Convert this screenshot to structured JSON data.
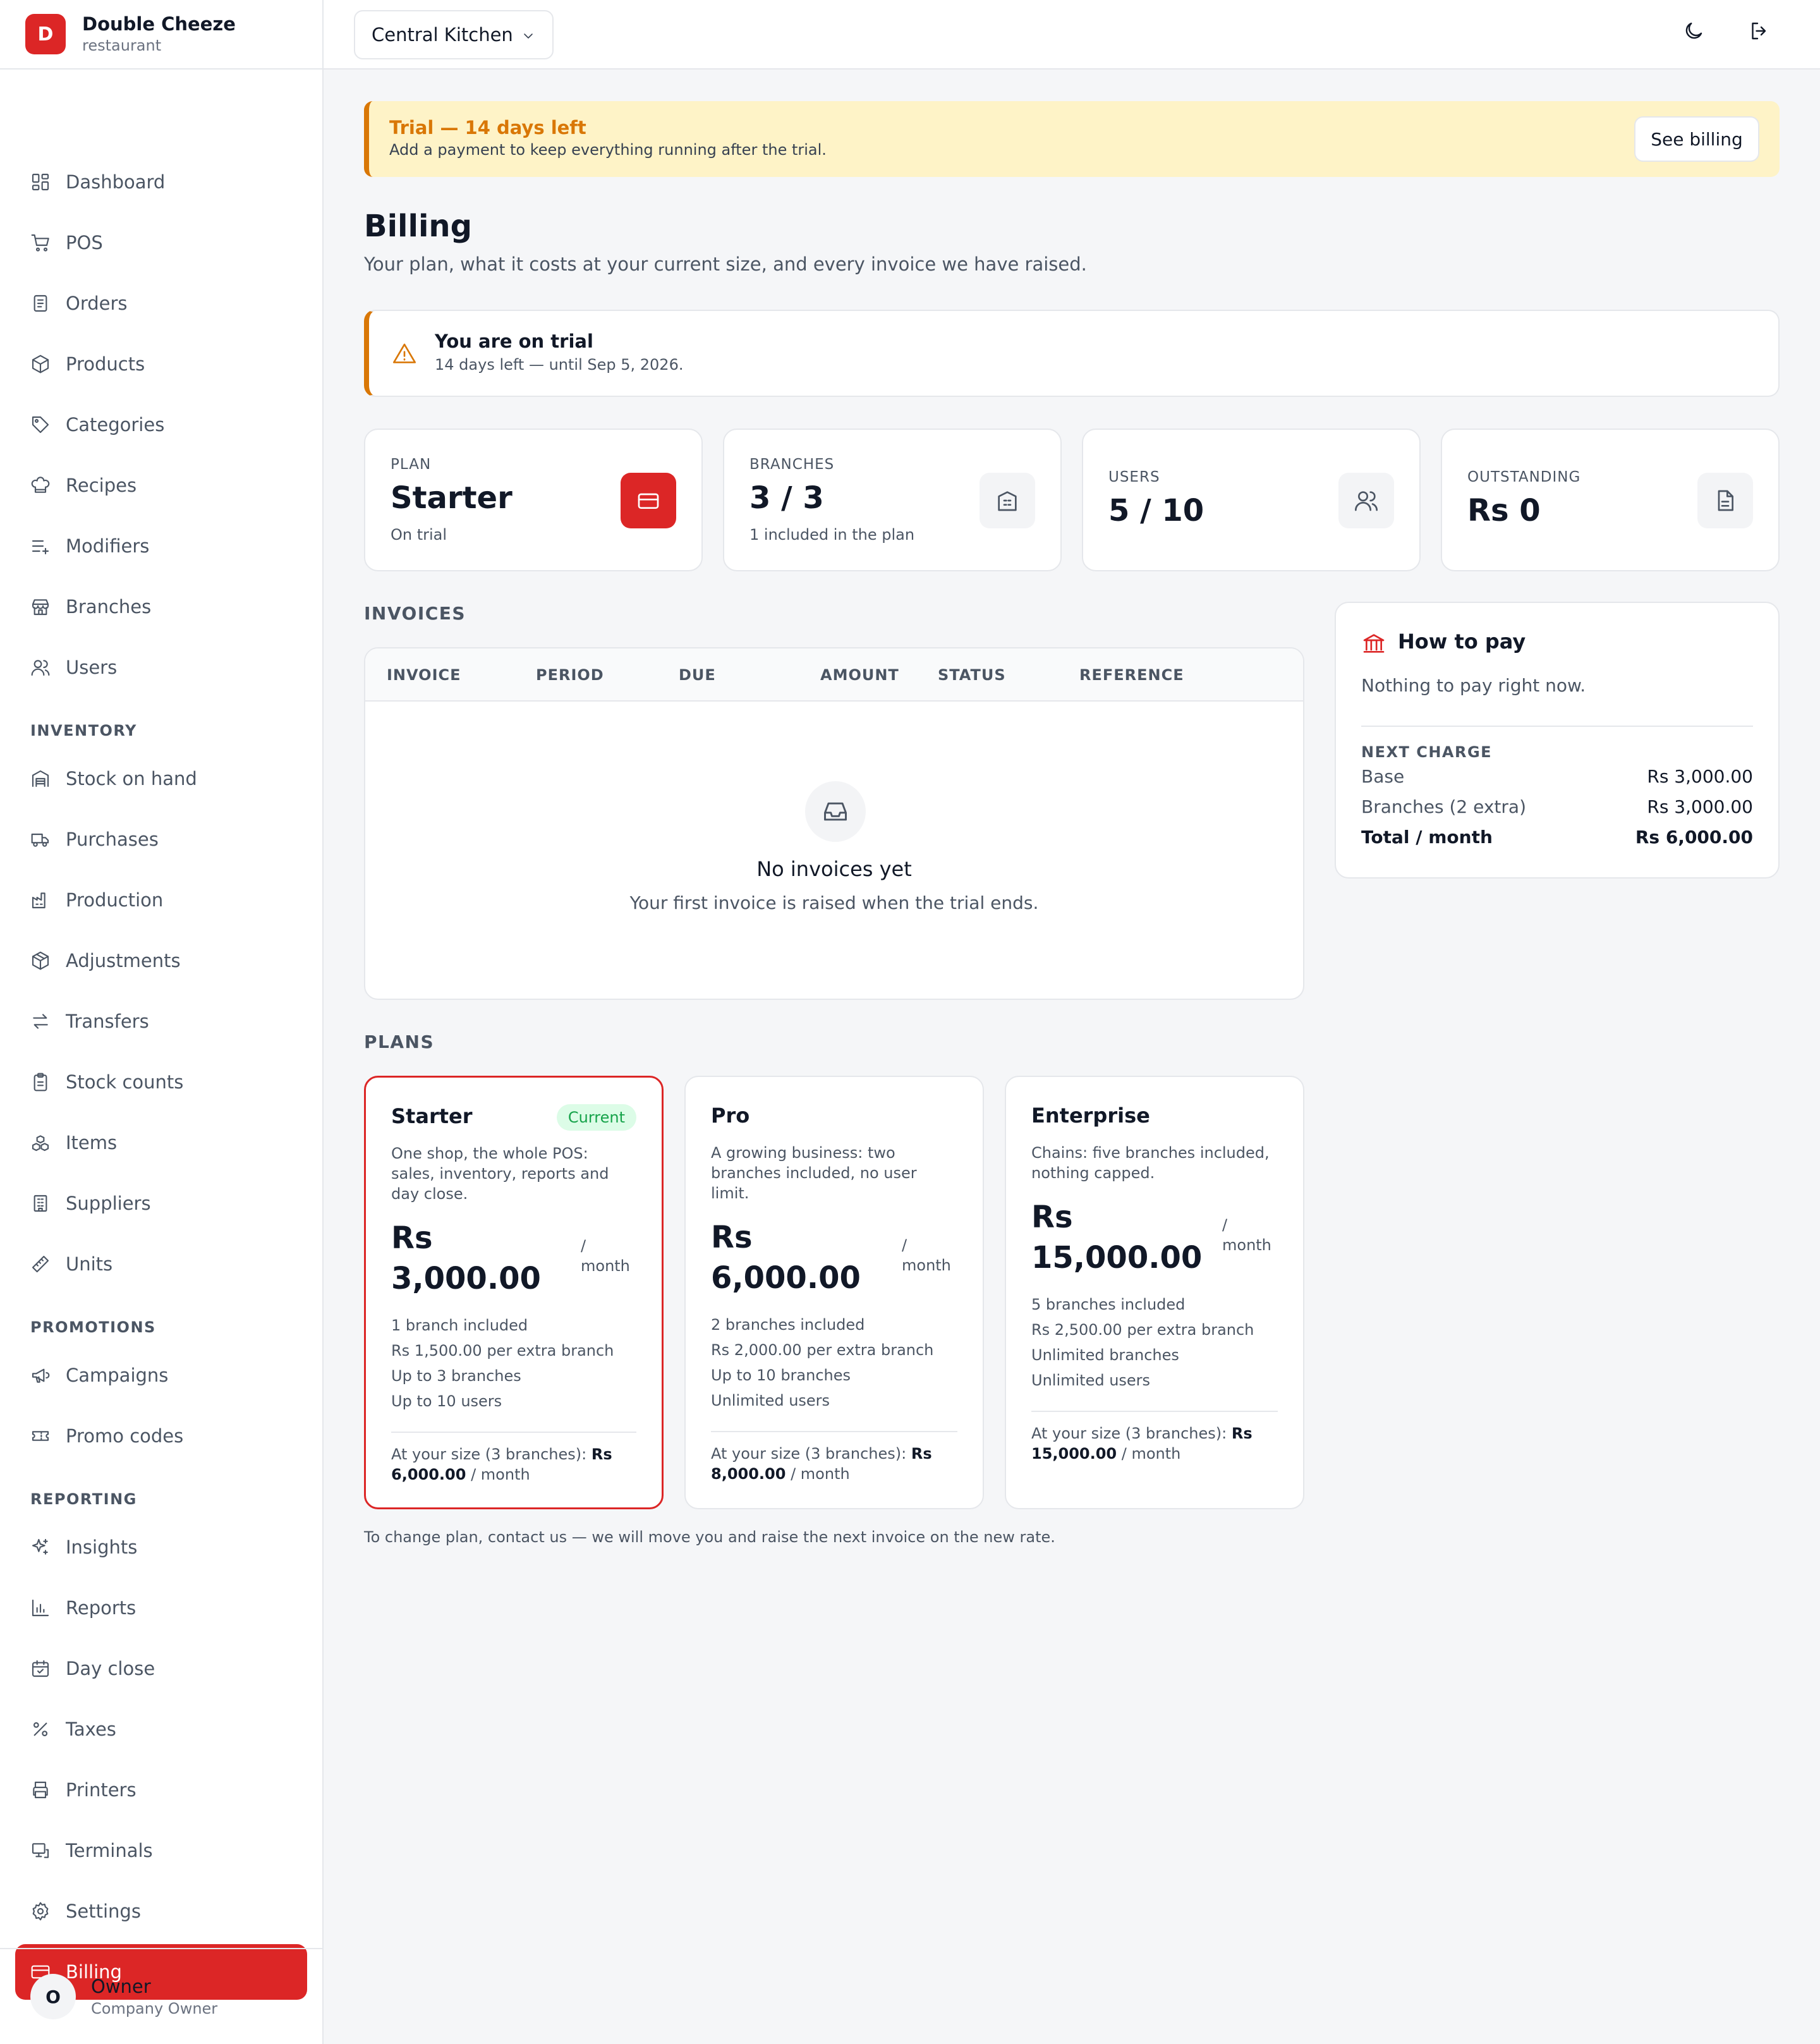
{
  "brand": {
    "initial": "D",
    "name": "Double Cheeze",
    "subtitle": "restaurant"
  },
  "sidebar": {
    "items": [
      {
        "label": "Dashboard",
        "icon": "dashboard-icon"
      },
      {
        "label": "POS",
        "icon": "cart-icon"
      },
      {
        "label": "Orders",
        "icon": "receipt-icon"
      },
      {
        "label": "Products",
        "icon": "box-icon"
      },
      {
        "label": "Categories",
        "icon": "tag-icon"
      },
      {
        "label": "Recipes",
        "icon": "chef-hat-icon"
      },
      {
        "label": "Modifiers",
        "icon": "list-plus-icon"
      },
      {
        "label": "Branches",
        "icon": "store-icon"
      },
      {
        "label": "Users",
        "icon": "users-icon"
      }
    ],
    "inventory_label": "INVENTORY",
    "inventory": [
      {
        "label": "Stock on hand",
        "icon": "warehouse-icon"
      },
      {
        "label": "Purchases",
        "icon": "truck-icon"
      },
      {
        "label": "Production",
        "icon": "factory-icon"
      },
      {
        "label": "Adjustments",
        "icon": "package-icon"
      },
      {
        "label": "Transfers",
        "icon": "arrows-icon"
      },
      {
        "label": "Stock counts",
        "icon": "clipboard-icon"
      },
      {
        "label": "Items",
        "icon": "boxes-icon"
      },
      {
        "label": "Suppliers",
        "icon": "building-icon"
      },
      {
        "label": "Units",
        "icon": "ruler-icon"
      }
    ],
    "promotions_label": "PROMOTIONS",
    "promotions": [
      {
        "label": "Campaigns",
        "icon": "megaphone-icon"
      },
      {
        "label": "Promo codes",
        "icon": "ticket-icon"
      }
    ],
    "reporting_label": "REPORTING",
    "reporting": [
      {
        "label": "Insights",
        "icon": "sparkles-icon"
      },
      {
        "label": "Reports",
        "icon": "bar-chart-icon"
      },
      {
        "label": "Day close",
        "icon": "calendar-check-icon"
      },
      {
        "label": "Taxes",
        "icon": "percent-icon"
      },
      {
        "label": "Printers",
        "icon": "printer-icon"
      },
      {
        "label": "Terminals",
        "icon": "monitor-icon"
      },
      {
        "label": "Settings",
        "icon": "gear-icon"
      },
      {
        "label": "Billing",
        "icon": "credit-card-icon",
        "active": true
      }
    ]
  },
  "user": {
    "initial": "O",
    "name": "Owner",
    "role": "Company Owner"
  },
  "topbar": {
    "branch": "Central Kitchen"
  },
  "banner": {
    "title": "Trial — 14 days left",
    "text": "Add a payment to keep everything running after the trial.",
    "button": "See billing"
  },
  "page": {
    "title": "Billing",
    "subtitle": "Your plan, what it costs at your current size, and every invoice we have raised."
  },
  "trial": {
    "title": "You are on trial",
    "text": "14 days left — until Sep 5, 2026."
  },
  "stats": [
    {
      "label": "PLAN",
      "value": "Starter",
      "sub": "On trial"
    },
    {
      "label": "BRANCHES",
      "value": "3 / 3",
      "sub": "1 included in the plan"
    },
    {
      "label": "USERS",
      "value": "5 / 10",
      "sub": ""
    },
    {
      "label": "OUTSTANDING",
      "value": "Rs 0",
      "sub": ""
    }
  ],
  "invoices": {
    "heading": "INVOICES",
    "columns": [
      "INVOICE",
      "PERIOD",
      "DUE",
      "AMOUNT",
      "STATUS",
      "REFERENCE"
    ],
    "empty_title": "No invoices yet",
    "empty_text": "Your first invoice is raised when the trial ends."
  },
  "pay": {
    "title": "How to pay",
    "text": "Nothing to pay right now.",
    "next_label": "NEXT CHARGE",
    "rows": [
      {
        "label": "Base",
        "value": "Rs 3,000.00"
      },
      {
        "label": "Branches (2 extra)",
        "value": "Rs 3,000.00"
      },
      {
        "label": "Total / month",
        "value": "Rs 6,000.00"
      }
    ]
  },
  "plans": {
    "heading": "PLANS",
    "current_badge": "Current",
    "per_slash": "/",
    "per_month": "month",
    "items": [
      {
        "name": "Starter",
        "desc": "One shop, the whole POS: sales, inventory, reports and day close.",
        "currency": "Rs",
        "amount": "3,000.00",
        "features": [
          "1 branch included",
          "Rs 1,500.00 per extra branch",
          "Up to 3 branches",
          "Up to 10 users"
        ],
        "foot_prefix": "At your size (3 branches):",
        "foot_price": "Rs 6,000.00",
        "foot_suffix": "/ month"
      },
      {
        "name": "Pro",
        "desc": "A growing business: two branches included, no user limit.",
        "currency": "Rs",
        "amount": "6,000.00",
        "features": [
          "2 branches included",
          "Rs 2,000.00 per extra branch",
          "Up to 10 branches",
          "Unlimited users"
        ],
        "foot_prefix": "At your size (3 branches):",
        "foot_price": "Rs 8,000.00",
        "foot_suffix": "/ month"
      },
      {
        "name": "Enterprise",
        "desc": "Chains: five branches included, nothing capped.",
        "currency": "Rs",
        "amount": "15,000.00",
        "features": [
          "5 branches included",
          "Rs 2,500.00 per extra branch",
          "Unlimited branches",
          "Unlimited users"
        ],
        "foot_prefix": "At your size (3 branches):",
        "foot_price": "Rs 15,000.00",
        "foot_suffix": "/ month"
      }
    ],
    "footnote": "To change plan, contact us — we will move you and raise the next invoice on the new rate."
  },
  "colors": {
    "accent": "#dc2626",
    "warning": "#d97706",
    "warning_bg": "#fef3c7",
    "success": "#16a34a"
  }
}
